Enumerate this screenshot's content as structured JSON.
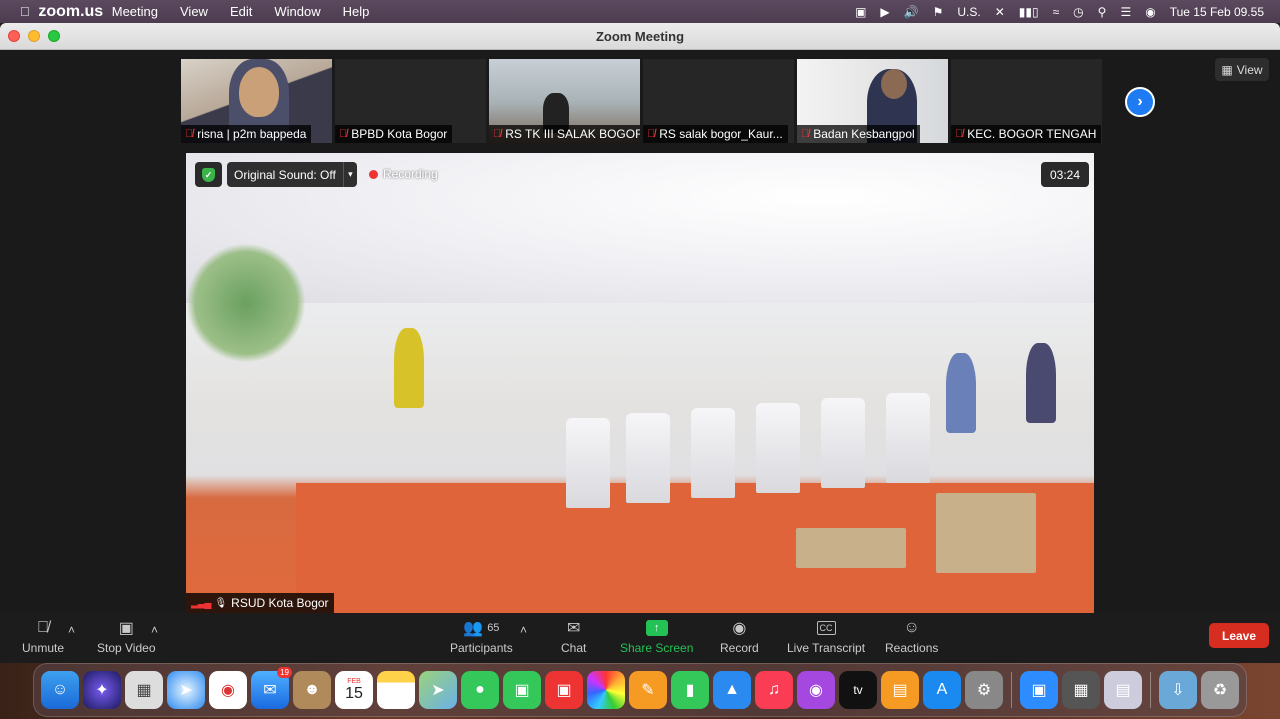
{
  "menubar": {
    "app_name": "zoom.us",
    "menus": [
      "Meeting",
      "View",
      "Edit",
      "Window",
      "Help"
    ],
    "input_source": "U.S.",
    "datetime": "Tue 15 Feb  09.55"
  },
  "window": {
    "title": "Zoom Meeting"
  },
  "thumbnails": [
    {
      "name": "risna | p2m bappeda"
    },
    {
      "name": "BPBD Kota Bogor"
    },
    {
      "name": "RS TK III SALAK BOGOR"
    },
    {
      "name": "RS salak bogor_Kaur..."
    },
    {
      "name": "Badan Kesbangpol"
    },
    {
      "name": "KEC. BOGOR TENGAH"
    }
  ],
  "view_button": "View",
  "main_video": {
    "original_sound": "Original Sound: Off",
    "recording": "Recording",
    "timer": "03:24",
    "speaker_name": "RSUD Kota Bogor"
  },
  "toolbar": {
    "unmute": "Unmute",
    "stop_video": "Stop Video",
    "participants_count": "65",
    "participants": "Participants",
    "chat": "Chat",
    "share_screen": "Share Screen",
    "record": "Record",
    "live_transcript": "Live Transcript",
    "cc": "CC",
    "reactions": "Reactions",
    "leave": "Leave"
  },
  "dock": {
    "calendar_month": "FEB",
    "calendar_day": "15",
    "mail_badge": "19",
    "tv_label": "tv"
  }
}
